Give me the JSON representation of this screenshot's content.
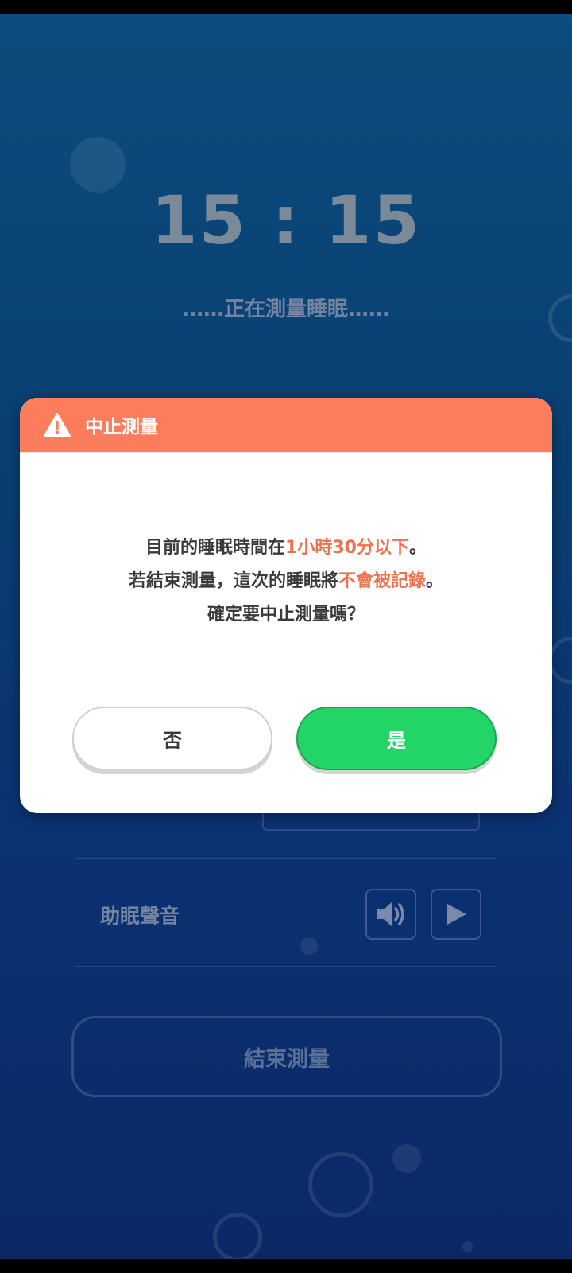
{
  "background": {
    "clock": "15 : 15",
    "status": "……正在測量睡眠……",
    "sound_label": "助眠聲音",
    "end_button": "結束測量"
  },
  "dialog": {
    "title": "中止測量",
    "line1_prefix": "目前的睡眠時間在",
    "line1_highlight": "1小時30分以下",
    "line1_suffix": "。",
    "line2_prefix": "若結束測量，這次的睡眠將",
    "line2_highlight": "不會被記錄",
    "line2_suffix": "。",
    "line3": "確定要中止測量嗎？",
    "no_label": "否",
    "yes_label": "是"
  },
  "colors": {
    "header": "#fb7d5b",
    "highlight": "#ef7150",
    "confirm": "#23d466"
  },
  "icons": {
    "header": "warning-icon",
    "volume": "speaker-icon",
    "play": "play-icon"
  }
}
